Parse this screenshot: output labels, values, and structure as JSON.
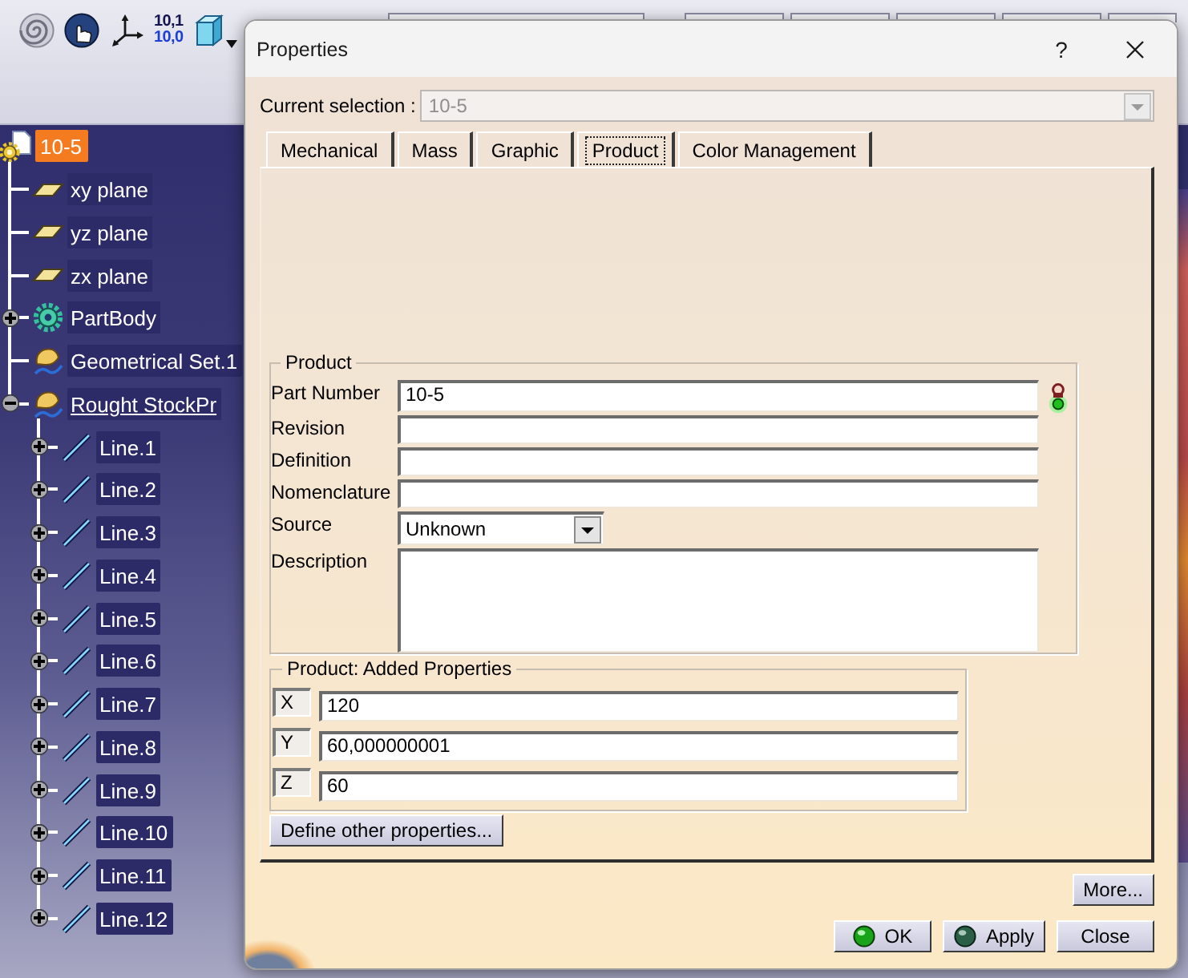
{
  "toolbar": {
    "buttons": [
      {
        "kind": "spiral",
        "dropdown": false
      },
      {
        "kind": "hand",
        "dropdown": false
      },
      {
        "kind": "axis",
        "dropdown": false
      },
      {
        "kind": "digits",
        "lines": [
          "10,1",
          "10,0"
        ],
        "dropdown": false
      },
      {
        "kind": "cube",
        "dropdown": true
      }
    ]
  },
  "tree": {
    "label": "10-5",
    "kind": "product",
    "selected": true,
    "in_work": false,
    "children": [
      {
        "label": "xy plane",
        "kind": "plane",
        "selected": false,
        "in_work": false
      },
      {
        "label": "yz plane",
        "kind": "plane",
        "selected": false,
        "in_work": false
      },
      {
        "label": "zx plane",
        "kind": "plane",
        "selected": false,
        "in_work": false
      },
      {
        "label": "PartBody",
        "kind": "body",
        "expanded": false,
        "selected": false,
        "in_work": false
      },
      {
        "label": "Geometrical Set.1",
        "kind": "geoset",
        "selected": false,
        "in_work": false
      },
      {
        "label": "Rought StockPr",
        "kind": "geoset",
        "expanded": true,
        "selected": false,
        "in_work": true,
        "children": [
          {
            "label": "Line.1",
            "kind": "line",
            "expanded": false,
            "selected": false,
            "in_work": false
          },
          {
            "label": "Line.2",
            "kind": "line",
            "expanded": false,
            "selected": false,
            "in_work": false
          },
          {
            "label": "Line.3",
            "kind": "line",
            "expanded": false,
            "selected": false,
            "in_work": false
          },
          {
            "label": "Line.4",
            "kind": "line",
            "expanded": false,
            "selected": false,
            "in_work": false
          },
          {
            "label": "Line.5",
            "kind": "line",
            "expanded": false,
            "selected": false,
            "in_work": false
          },
          {
            "label": "Line.6",
            "kind": "line",
            "expanded": false,
            "selected": false,
            "in_work": false
          },
          {
            "label": "Line.7",
            "kind": "line",
            "expanded": false,
            "selected": false,
            "in_work": false
          },
          {
            "label": "Line.8",
            "kind": "line",
            "expanded": false,
            "selected": false,
            "in_work": false
          },
          {
            "label": "Line.9",
            "kind": "line",
            "expanded": false,
            "selected": false,
            "in_work": false
          },
          {
            "label": "Line.10",
            "kind": "line",
            "expanded": false,
            "selected": false,
            "in_work": false
          },
          {
            "label": "Line.11",
            "kind": "line",
            "expanded": false,
            "selected": false,
            "in_work": false
          },
          {
            "label": "Line.12",
            "kind": "line",
            "expanded": false,
            "selected": false,
            "in_work": false
          }
        ]
      }
    ]
  },
  "dialog": {
    "title": "Properties",
    "help": "?",
    "current_selection": {
      "label": "Current selection :",
      "value": "10-5",
      "disabled": true
    },
    "tabs": [
      {
        "label": "Mechanical",
        "selected": false
      },
      {
        "label": "Mass",
        "selected": false
      },
      {
        "label": "Graphic",
        "selected": false
      },
      {
        "label": "Product",
        "selected": true
      },
      {
        "label": "Color Management",
        "selected": false
      }
    ],
    "product": {
      "title": "Product",
      "fields": [
        {
          "label": "Part Number",
          "kind": "text",
          "value": "10-5",
          "lock": true
        },
        {
          "label": "Revision",
          "kind": "text",
          "lock": false
        },
        {
          "label": "Definition",
          "kind": "text",
          "lock": false
        },
        {
          "label": "Nomenclature",
          "kind": "text",
          "lock": false
        },
        {
          "label": "Source",
          "kind": "select",
          "value": "Unknown",
          "lock": false
        },
        {
          "label": "Description",
          "kind": "textarea",
          "lock": false
        }
      ]
    },
    "added_properties": {
      "title": "Product: Added Properties",
      "rows": [
        {
          "label": "X",
          "value": "120"
        },
        {
          "label": "Y",
          "value": "60,000000001"
        },
        {
          "label": "Z",
          "value": "60"
        }
      ]
    },
    "define_button": "Define other properties...",
    "more_button": "More...",
    "buttons": [
      {
        "label": "OK",
        "kind": "ok"
      },
      {
        "label": "Apply",
        "kind": "apply"
      },
      {
        "label": "Close",
        "kind": "plain"
      }
    ]
  }
}
